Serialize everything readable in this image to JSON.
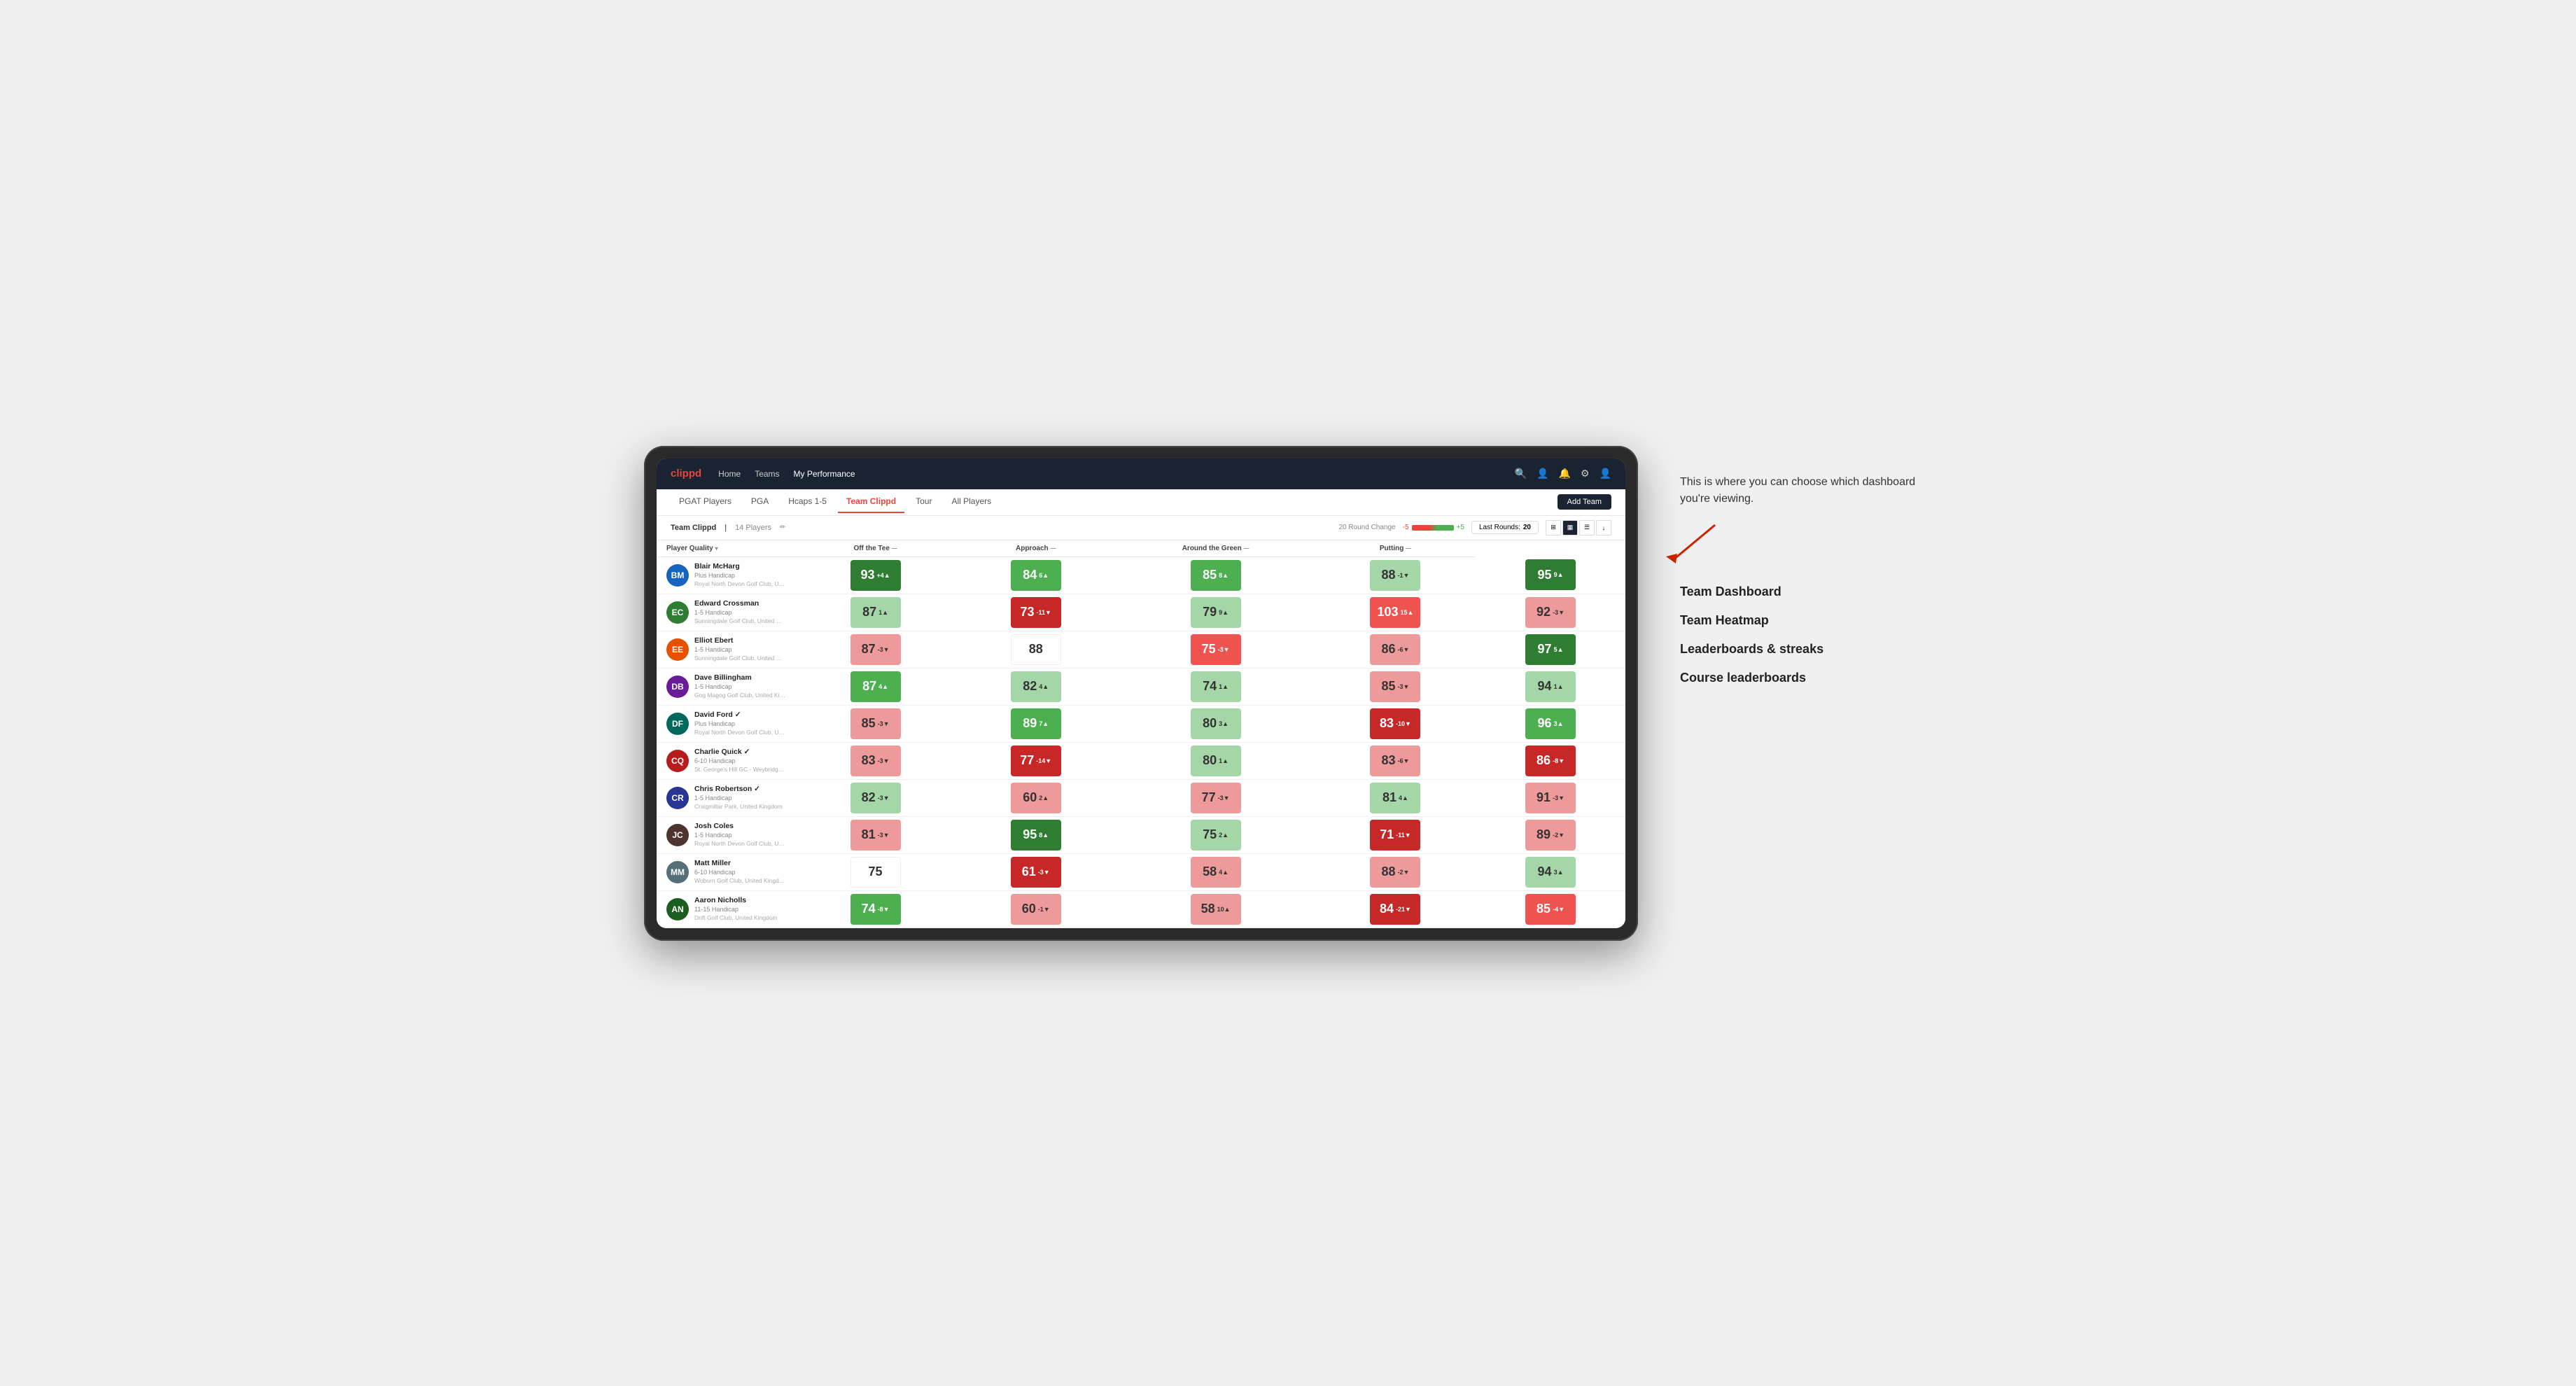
{
  "nav": {
    "logo": "clippd",
    "links": [
      "Home",
      "Teams",
      "My Performance"
    ],
    "active_link": "My Performance"
  },
  "sub_nav": {
    "links": [
      "PGAT Players",
      "PGA",
      "Hcaps 1-5",
      "Team Clippd",
      "Tour",
      "All Players"
    ],
    "active": "Team Clippd",
    "add_team_label": "Add Team"
  },
  "team_bar": {
    "team_name": "Team Clippd",
    "separator": "|",
    "player_count": "14 Players",
    "round_change_label": "20 Round Change",
    "change_neg": "-5",
    "change_pos": "+5",
    "last_rounds_label": "Last Rounds:",
    "last_rounds_value": "20"
  },
  "table": {
    "columns": [
      {
        "id": "player",
        "label": "Player Quality"
      },
      {
        "id": "tee",
        "label": "Off the Tee"
      },
      {
        "id": "approach",
        "label": "Approach"
      },
      {
        "id": "around",
        "label": "Around the Green"
      },
      {
        "id": "putting",
        "label": "Putting"
      }
    ],
    "players": [
      {
        "name": "Blair McHarg",
        "handicap": "Plus Handicap",
        "club": "Royal North Devon Golf Club, United Kingdom",
        "initials": "BM",
        "av_class": "av-blue",
        "scores": [
          {
            "value": 93,
            "change": "+4",
            "dir": "up",
            "bg": "bg-green-strong"
          },
          {
            "value": 84,
            "change": "6",
            "dir": "up",
            "bg": "bg-green-mid"
          },
          {
            "value": 85,
            "change": "8",
            "dir": "up",
            "bg": "bg-green-mid"
          },
          {
            "value": 88,
            "change": "-1",
            "dir": "down",
            "bg": "bg-green-light"
          },
          {
            "value": 95,
            "change": "9",
            "dir": "up",
            "bg": "bg-green-strong"
          }
        ]
      },
      {
        "name": "Edward Crossman",
        "handicap": "1-5 Handicap",
        "club": "Sunningdale Golf Club, United Kingdom",
        "initials": "EC",
        "av_class": "av-green",
        "scores": [
          {
            "value": 87,
            "change": "1",
            "dir": "up",
            "bg": "bg-green-light"
          },
          {
            "value": 73,
            "change": "-11",
            "dir": "down",
            "bg": "bg-red-strong"
          },
          {
            "value": 79,
            "change": "9",
            "dir": "up",
            "bg": "bg-green-light"
          },
          {
            "value": 103,
            "change": "15",
            "dir": "up",
            "bg": "bg-red-mid"
          },
          {
            "value": 92,
            "change": "-3",
            "dir": "down",
            "bg": "bg-red-light"
          }
        ]
      },
      {
        "name": "Elliot Ebert",
        "handicap": "1-5 Handicap",
        "club": "Sunningdale Golf Club, United Kingdom",
        "initials": "EE",
        "av_class": "av-orange",
        "scores": [
          {
            "value": 87,
            "change": "-3",
            "dir": "down",
            "bg": "bg-red-light"
          },
          {
            "value": 88,
            "change": "",
            "dir": "",
            "bg": "bg-neutral"
          },
          {
            "value": 75,
            "change": "-3",
            "dir": "down",
            "bg": "bg-red-mid"
          },
          {
            "value": 86,
            "change": "-6",
            "dir": "down",
            "bg": "bg-red-light"
          },
          {
            "value": 97,
            "change": "5",
            "dir": "up",
            "bg": "bg-green-strong"
          }
        ]
      },
      {
        "name": "Dave Billingham",
        "handicap": "1-5 Handicap",
        "club": "Gog Magog Golf Club, United Kingdom",
        "initials": "DB",
        "av_class": "av-purple",
        "scores": [
          {
            "value": 87,
            "change": "4",
            "dir": "up",
            "bg": "bg-green-mid"
          },
          {
            "value": 82,
            "change": "4",
            "dir": "up",
            "bg": "bg-green-light"
          },
          {
            "value": 74,
            "change": "1",
            "dir": "up",
            "bg": "bg-green-light"
          },
          {
            "value": 85,
            "change": "-3",
            "dir": "down",
            "bg": "bg-red-light"
          },
          {
            "value": 94,
            "change": "1",
            "dir": "up",
            "bg": "bg-green-light"
          }
        ]
      },
      {
        "name": "David Ford ✓",
        "handicap": "Plus Handicap",
        "club": "Royal North Devon Golf Club, United Kingdom",
        "initials": "DF",
        "av_class": "av-teal",
        "scores": [
          {
            "value": 85,
            "change": "-3",
            "dir": "down",
            "bg": "bg-red-light"
          },
          {
            "value": 89,
            "change": "7",
            "dir": "up",
            "bg": "bg-green-mid"
          },
          {
            "value": 80,
            "change": "3",
            "dir": "up",
            "bg": "bg-green-light"
          },
          {
            "value": 83,
            "change": "-10",
            "dir": "down",
            "bg": "bg-red-strong"
          },
          {
            "value": 96,
            "change": "3",
            "dir": "up",
            "bg": "bg-green-mid"
          }
        ]
      },
      {
        "name": "Charlie Quick ✓",
        "handicap": "6-10 Handicap",
        "club": "St. George's Hill GC - Weybridge - Surrey, Uni...",
        "initials": "CQ",
        "av_class": "av-red",
        "scores": [
          {
            "value": 83,
            "change": "-3",
            "dir": "down",
            "bg": "bg-red-light"
          },
          {
            "value": 77,
            "change": "-14",
            "dir": "down",
            "bg": "bg-red-strong"
          },
          {
            "value": 80,
            "change": "1",
            "dir": "up",
            "bg": "bg-green-light"
          },
          {
            "value": 83,
            "change": "-6",
            "dir": "down",
            "bg": "bg-red-light"
          },
          {
            "value": 86,
            "change": "-8",
            "dir": "down",
            "bg": "bg-red-strong"
          }
        ]
      },
      {
        "name": "Chris Robertson ✓",
        "handicap": "1-5 Handicap",
        "club": "Craigmillar Park, United Kingdom",
        "initials": "CR",
        "av_class": "av-indigo",
        "scores": [
          {
            "value": 82,
            "change": "-3",
            "dir": "down",
            "bg": "bg-green-light"
          },
          {
            "value": 60,
            "change": "2",
            "dir": "up",
            "bg": "bg-red-light"
          },
          {
            "value": 77,
            "change": "-3",
            "dir": "down",
            "bg": "bg-red-light"
          },
          {
            "value": 81,
            "change": "4",
            "dir": "up",
            "bg": "bg-green-light"
          },
          {
            "value": 91,
            "change": "-3",
            "dir": "down",
            "bg": "bg-red-light"
          }
        ]
      },
      {
        "name": "Josh Coles",
        "handicap": "1-5 Handicap",
        "club": "Royal North Devon Golf Club, United Kingdom",
        "initials": "JC",
        "av_class": "av-brown",
        "scores": [
          {
            "value": 81,
            "change": "-3",
            "dir": "down",
            "bg": "bg-red-light"
          },
          {
            "value": 95,
            "change": "8",
            "dir": "up",
            "bg": "bg-green-strong"
          },
          {
            "value": 75,
            "change": "2",
            "dir": "up",
            "bg": "bg-green-light"
          },
          {
            "value": 71,
            "change": "-11",
            "dir": "down",
            "bg": "bg-red-strong"
          },
          {
            "value": 89,
            "change": "-2",
            "dir": "down",
            "bg": "bg-red-light"
          }
        ]
      },
      {
        "name": "Matt Miller",
        "handicap": "6-10 Handicap",
        "club": "Woburn Golf Club, United Kingdom",
        "initials": "MM",
        "av_class": "av-gray",
        "scores": [
          {
            "value": 75,
            "change": "",
            "dir": "",
            "bg": "bg-neutral"
          },
          {
            "value": 61,
            "change": "-3",
            "dir": "down",
            "bg": "bg-red-strong"
          },
          {
            "value": 58,
            "change": "4",
            "dir": "up",
            "bg": "bg-red-light"
          },
          {
            "value": 88,
            "change": "-2",
            "dir": "down",
            "bg": "bg-red-light"
          },
          {
            "value": 94,
            "change": "3",
            "dir": "up",
            "bg": "bg-green-light"
          }
        ]
      },
      {
        "name": "Aaron Nicholls",
        "handicap": "11-15 Handicap",
        "club": "Drift Golf Club, United Kingdom",
        "initials": "AN",
        "av_class": "av-darkgreen",
        "scores": [
          {
            "value": 74,
            "change": "-8",
            "dir": "down",
            "bg": "bg-green-mid"
          },
          {
            "value": 60,
            "change": "-1",
            "dir": "down",
            "bg": "bg-red-light"
          },
          {
            "value": 58,
            "change": "10",
            "dir": "up",
            "bg": "bg-red-light"
          },
          {
            "value": 84,
            "change": "-21",
            "dir": "down",
            "bg": "bg-red-strong"
          },
          {
            "value": 85,
            "change": "-4",
            "dir": "down",
            "bg": "bg-red-mid"
          }
        ]
      }
    ]
  },
  "annotation": {
    "intro": "This is where you can choose which dashboard you're viewing.",
    "items": [
      "Team Dashboard",
      "Team Heatmap",
      "Leaderboards & streaks",
      "Course leaderboards"
    ]
  }
}
